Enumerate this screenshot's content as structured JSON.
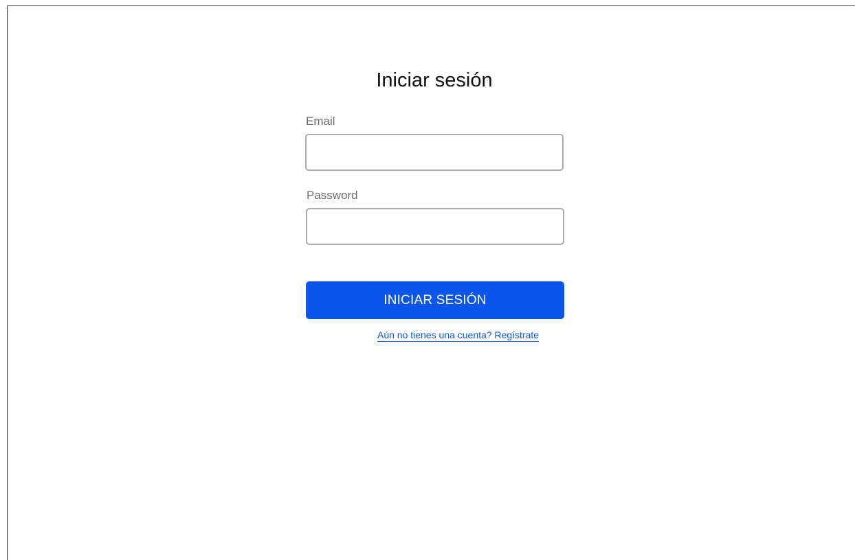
{
  "page": {
    "title": "Iniciar sesión"
  },
  "form": {
    "email_label": "Email",
    "email_value": "",
    "email_placeholder": "",
    "password_label": "Password",
    "password_value": "",
    "password_placeholder": "",
    "submit_label": "INICIAR SESIÓN",
    "register_link": "Aún no tienes una cuenta? Regístrate"
  },
  "colors": {
    "primary": "#0b55ea",
    "input_border": "#a9a9a9",
    "label_text": "#6b6b6b",
    "title_text": "#111111"
  }
}
